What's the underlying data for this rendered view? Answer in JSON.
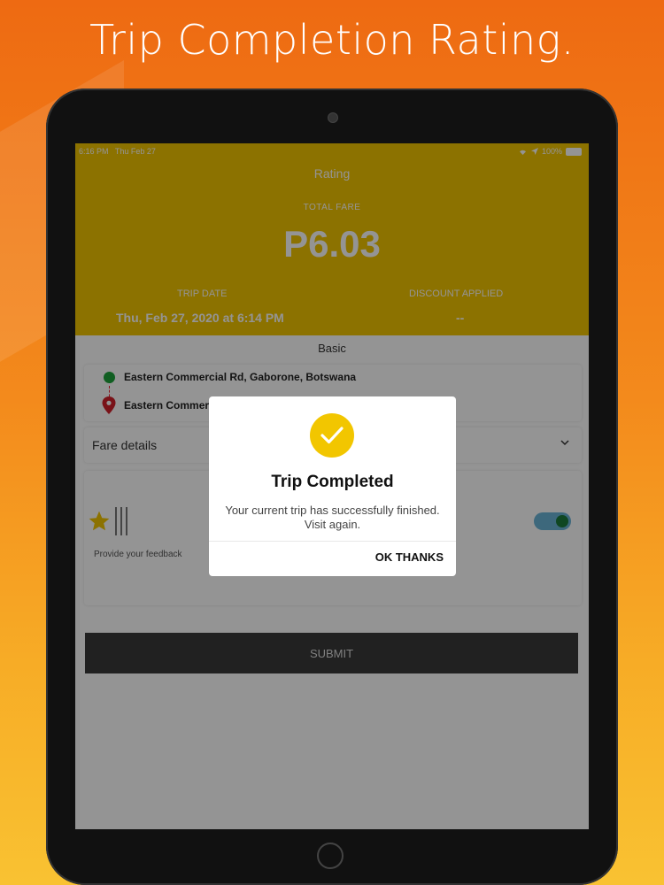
{
  "headline": "Trip Completion Rating.",
  "status": {
    "time": "6:16 PM",
    "date": "Thu Feb 27",
    "battery": "100%"
  },
  "screen": {
    "title": "Rating",
    "total_fare_label": "TOTAL FARE",
    "total_fare": "P6.03",
    "trip_date_label": "TRIP DATE",
    "trip_date": "Thu, Feb 27, 2020 at 6:14 PM",
    "discount_label": "DISCOUNT APPLIED",
    "discount_value": "--"
  },
  "ride_type": "Basic",
  "route": {
    "pickup": "Eastern Commercial Rd,  Gaborone,  Botswana",
    "dropoff": "Eastern Commercial Rd,  Gaborone,  Botswana"
  },
  "fare_details_label": "Fare details",
  "feedback_label": "Provide your feedback",
  "submit_label": "SUBMIT",
  "dialog": {
    "title": "Trip Completed",
    "message": "Your current trip has successfully finished. Visit again.",
    "button": "OK THANKS"
  },
  "colors": {
    "brand": "#f2c500",
    "header_text": "#ffffff",
    "submit_bg": "#3a3a3a"
  },
  "icons": [
    "wifi-icon",
    "location-arrow-icon",
    "battery-icon",
    "check-icon",
    "pin-icon",
    "chevron-down-icon",
    "star-icon"
  ]
}
